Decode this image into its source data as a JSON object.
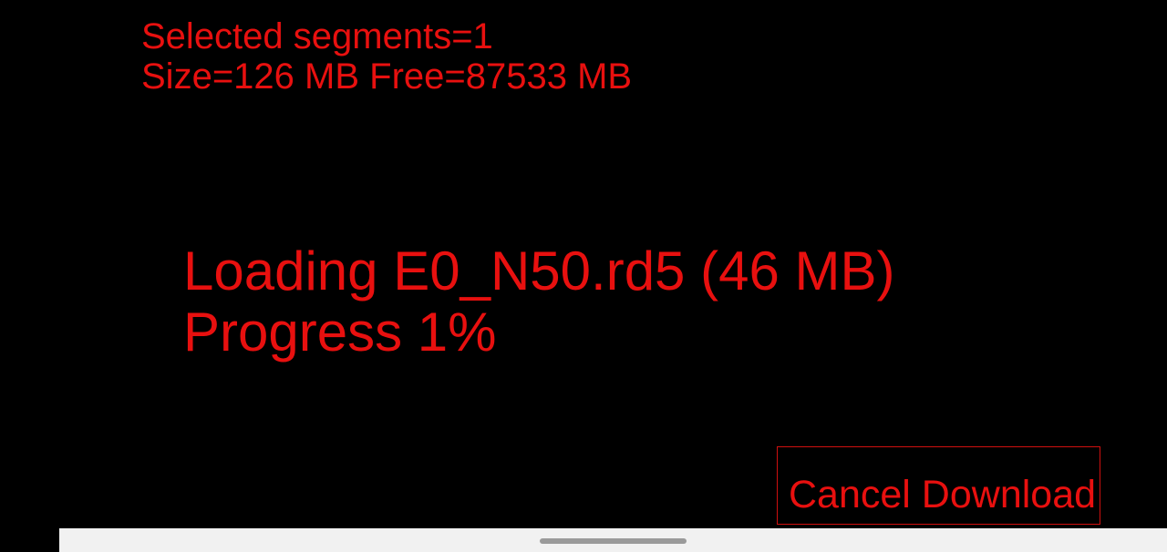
{
  "selection": {
    "segments_text": "Selected segments=1",
    "size_text": "Size=126 MB Free=87533 MB"
  },
  "download": {
    "loading_text": "Loading E0_N50.rd5 (46 MB)",
    "progress_text": "Progress 1%",
    "progress_value": 0.01
  },
  "actions": {
    "cancel_label": "Cancel Download"
  },
  "colors": {
    "background": "#000000",
    "text": "#e8100f",
    "nav_bar": "#f1f1f1",
    "home_handle": "#9a9a9a"
  }
}
